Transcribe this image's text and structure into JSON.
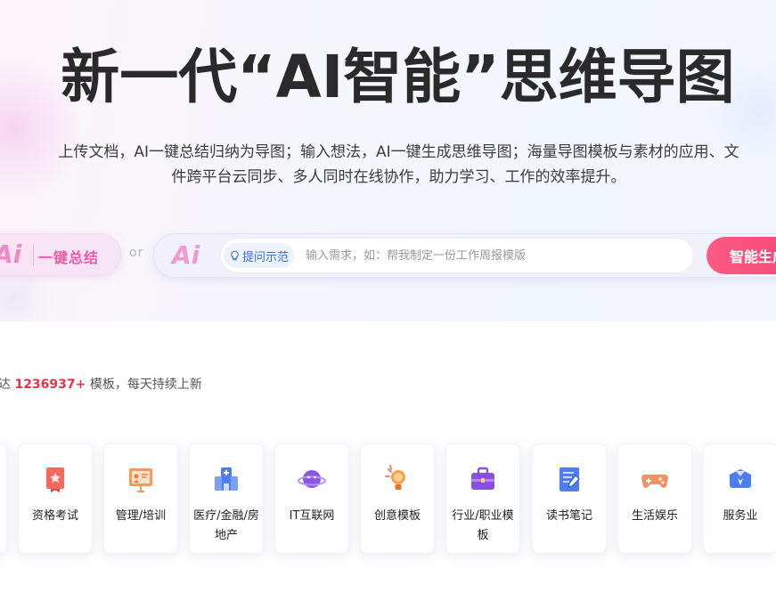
{
  "hero": {
    "title": "新一代“AI智能”思维导图",
    "subtitle": "上传文档，AI一键总结归纳为导图；输入想法，AI一键生成思维导图；海量导图模板与素材的应用、文件跨平台云同步、多人同时在线协作，助力学习、工作的效率提升。"
  },
  "summary_pill": {
    "ai_text": "Ai",
    "label": "一键总结"
  },
  "or_text": "or",
  "search": {
    "ai_text": "Ai",
    "tip_label": "提问示范",
    "placeholder": "输入需求，如：帮我制定一份工作周报模版",
    "generate_label": "智能生成"
  },
  "count": {
    "prefix": "达",
    "number": "1236937+",
    "suffix": "模板，每天持续上新"
  },
  "categories": [
    {
      "label": "资格考试",
      "icon": "certificate-icon"
    },
    {
      "label": "管理/培训",
      "icon": "presentation-icon"
    },
    {
      "label": "医疗/金融/房地产",
      "icon": "building-icon"
    },
    {
      "label": "IT互联网",
      "icon": "planet-icon"
    },
    {
      "label": "创意模板",
      "icon": "lightbulb-icon"
    },
    {
      "label": "行业/职业模板",
      "icon": "briefcase-icon"
    },
    {
      "label": "读书笔记",
      "icon": "notebook-icon"
    },
    {
      "label": "生活娱乐",
      "icon": "gamepad-icon"
    },
    {
      "label": "服务业",
      "icon": "service-icon"
    }
  ],
  "colors": {
    "accent": "#f63f73",
    "count_highlight": "#e8334a",
    "tip_blue": "#3b6fd9"
  }
}
